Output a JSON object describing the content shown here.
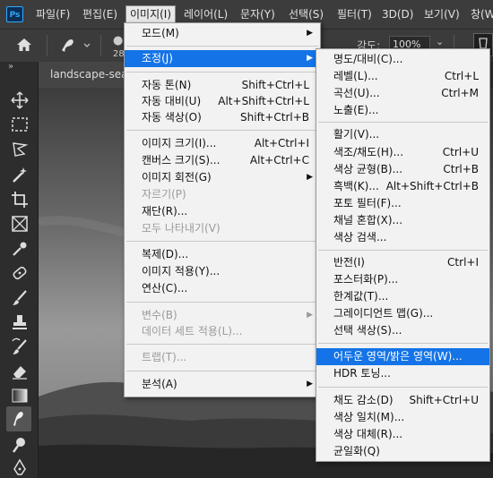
{
  "app": {
    "logo": "Ps"
  },
  "menubar": {
    "items": [
      "파일(F)",
      "편집(E)",
      "이미지(I)",
      "레이어(L)",
      "문자(Y)",
      "선택(S)",
      "필터(T)",
      "3D(D)",
      "보기(V)",
      "창(W)"
    ]
  },
  "options": {
    "flow_label": "강도:",
    "flow_value": "100%",
    "brush_size": "28"
  },
  "document": {
    "tab_title": "landscape-sea"
  },
  "image_menu": {
    "items": [
      {
        "label": "모드(M)",
        "submenu": true
      },
      {
        "label": "조정(J)",
        "submenu": true,
        "highlighted": true
      },
      {
        "label": "자동 톤(N)",
        "shortcut": "Shift+Ctrl+L"
      },
      {
        "label": "자동 대비(U)",
        "shortcut": "Alt+Shift+Ctrl+L"
      },
      {
        "label": "자동 색상(O)",
        "shortcut": "Shift+Ctrl+B"
      },
      {
        "label": "이미지 크기(I)...",
        "shortcut": "Alt+Ctrl+I"
      },
      {
        "label": "캔버스 크기(S)...",
        "shortcut": "Alt+Ctrl+C"
      },
      {
        "label": "이미지 회전(G)",
        "submenu": true
      },
      {
        "label": "자르기(P)",
        "disabled": true
      },
      {
        "label": "재단(R)..."
      },
      {
        "label": "모두 나타내기(V)",
        "disabled": true
      },
      {
        "label": "복제(D)..."
      },
      {
        "label": "이미지 적용(Y)..."
      },
      {
        "label": "연산(C)..."
      },
      {
        "label": "변수(B)",
        "submenu": true,
        "disabled": true
      },
      {
        "label": "데이터 세트 적용(L)...",
        "disabled": true
      },
      {
        "label": "트랩(T)...",
        "disabled": true
      },
      {
        "label": "분석(A)",
        "submenu": true
      }
    ]
  },
  "adjust_menu": {
    "items": [
      {
        "label": "명도/대비(C)..."
      },
      {
        "label": "레벨(L)...",
        "shortcut": "Ctrl+L"
      },
      {
        "label": "곡선(U)...",
        "shortcut": "Ctrl+M"
      },
      {
        "label": "노출(E)..."
      },
      {
        "label": "활기(V)..."
      },
      {
        "label": "색조/채도(H)...",
        "shortcut": "Ctrl+U"
      },
      {
        "label": "색상 균형(B)...",
        "shortcut": "Ctrl+B"
      },
      {
        "label": "흑백(K)...",
        "shortcut": "Alt+Shift+Ctrl+B"
      },
      {
        "label": "포토 필터(F)..."
      },
      {
        "label": "채널 혼합(X)..."
      },
      {
        "label": "색상 검색..."
      },
      {
        "label": "반전(I)",
        "shortcut": "Ctrl+I"
      },
      {
        "label": "포스터화(P)..."
      },
      {
        "label": "한계값(T)..."
      },
      {
        "label": "그레이디언트 맵(G)..."
      },
      {
        "label": "선택 색상(S)..."
      },
      {
        "label": "어두운 영역/밝은 영역(W)...",
        "highlighted": true
      },
      {
        "label": "HDR 토닝..."
      },
      {
        "label": "채도 감소(D)",
        "shortcut": "Shift+Ctrl+U"
      },
      {
        "label": "색상 일치(M)..."
      },
      {
        "label": "색상 대체(R)..."
      },
      {
        "label": "균일화(Q)"
      }
    ]
  },
  "colors": {
    "highlight": "#1473e6",
    "menu_bg": "#f2f2f2",
    "chrome": "#3c3c3c"
  }
}
